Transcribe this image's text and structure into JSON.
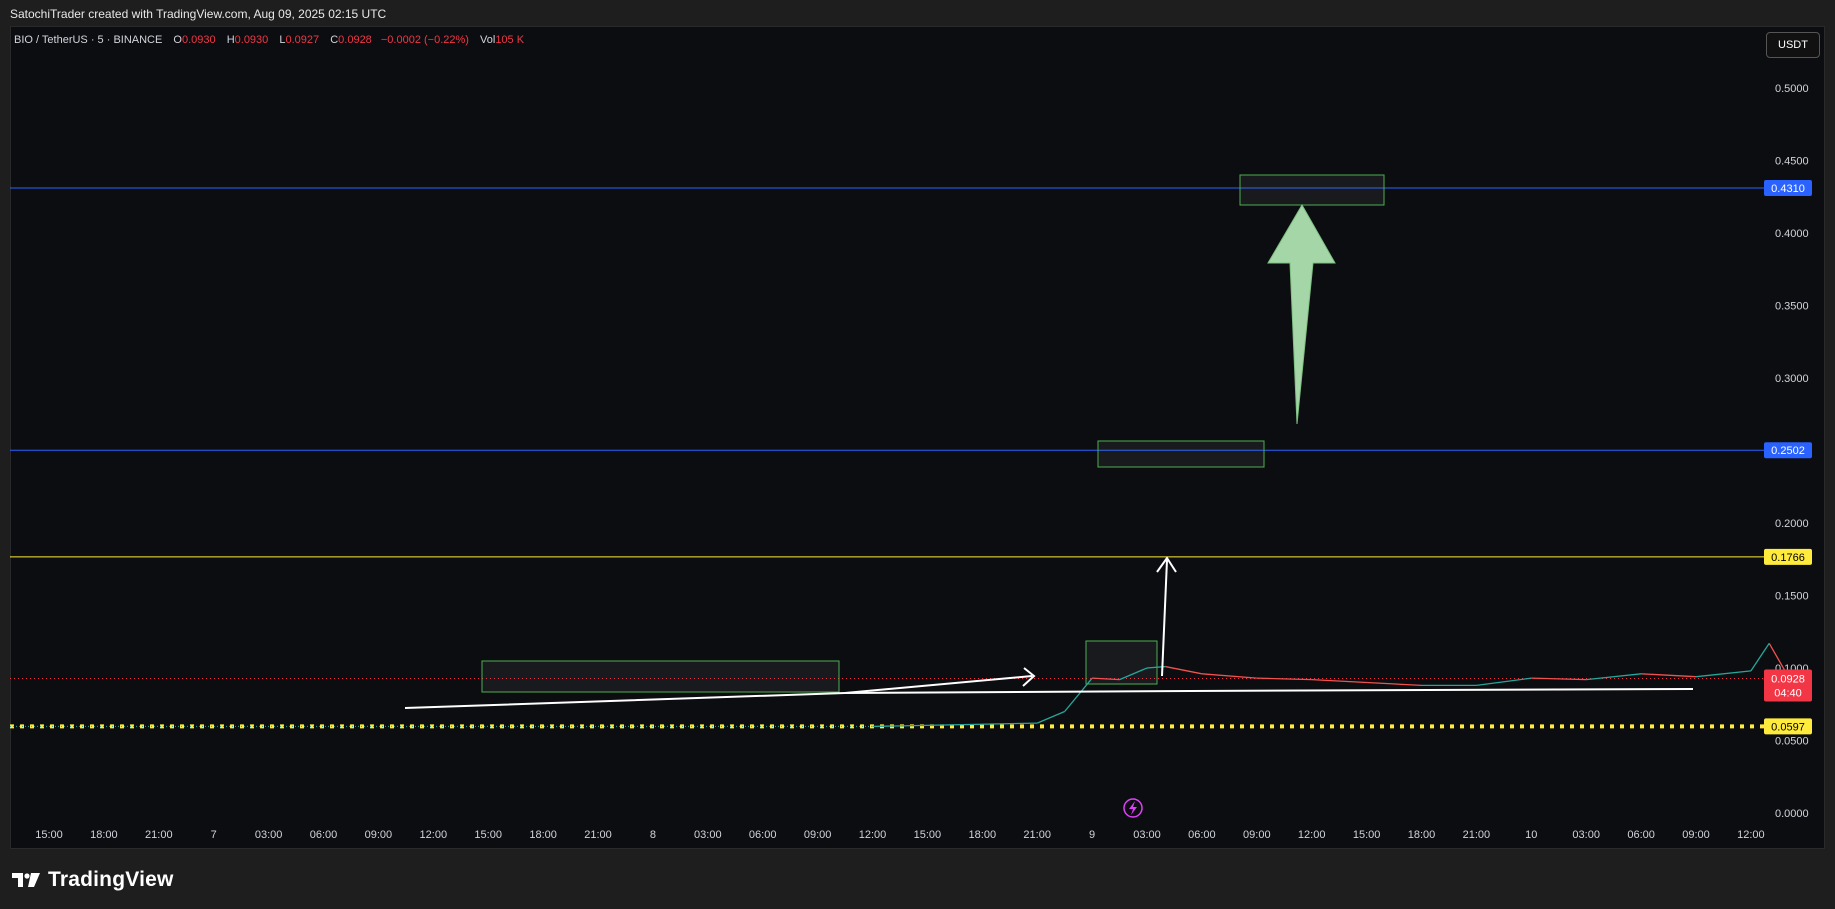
{
  "header": {
    "attribution": "SatochiTrader created with TradingView.com, Aug 09, 2025 02:15 UTC"
  },
  "legend": {
    "symbol": "BIO / TetherUS · 5 · BINANCE",
    "open_label": "O",
    "open": "0.0930",
    "high_label": "H",
    "high": "0.0930",
    "low_label": "L",
    "low": "0.0927",
    "close_label": "C",
    "close": "0.0928",
    "change": "−0.0002 (−0.22%)",
    "vol_label": "Vol",
    "vol": "105 K"
  },
  "currency_button": "USDT",
  "logo": {
    "text": "TradingView",
    "icon": "tradingview-logo-icon"
  },
  "colors": {
    "background": "#0c0d10",
    "blue_level": "#2962ff",
    "yellow_level": "#ffeb3b",
    "price_red": "#f23645",
    "box_green": "#4caf50",
    "big_arrow": "#a5d6a7",
    "volume_icon": "#e040fb"
  },
  "chart_data": {
    "type": "line",
    "title": "",
    "y_axis": {
      "ticks": [
        "0.5000",
        "0.4500",
        "0.4000",
        "0.3500",
        "0.3000",
        "0.2500",
        "0.2000",
        "0.1500",
        "0.1000",
        "0.0500",
        "0.0000"
      ],
      "ylim": [
        0,
        0.52
      ],
      "side": "right"
    },
    "x_axis": {
      "ticks": [
        "15:00",
        "18:00",
        "21:00",
        "7",
        "03:00",
        "06:00",
        "09:00",
        "12:00",
        "15:00",
        "18:00",
        "21:00",
        "8",
        "03:00",
        "06:00",
        "09:00",
        "12:00",
        "15:00",
        "18:00",
        "21:00",
        "9",
        "03:00",
        "06:00",
        "09:00",
        "12:00",
        "15:00",
        "18:00",
        "21:00",
        "10",
        "03:00",
        "06:00",
        "09:00",
        "12:00"
      ]
    },
    "price_levels": [
      {
        "value": 0.431,
        "label": "0.4310",
        "style": "solid",
        "color": "blue"
      },
      {
        "value": 0.2502,
        "label": "0.2502",
        "style": "solid",
        "color": "blue"
      },
      {
        "value": 0.1766,
        "label": "0.1766",
        "style": "solid",
        "color": "yellow"
      },
      {
        "value": 0.0597,
        "label": "0.0597",
        "style": "dotted",
        "color": "yellow"
      }
    ],
    "current_price": {
      "value": 0.0928,
      "label": "0.0928",
      "countdown": "04:40"
    },
    "series": [
      {
        "x": [
          "06:00",
          "09:00",
          "10:30",
          "12:00",
          "13:30",
          "15:00",
          "16:00",
          "18:00",
          "21:00",
          "8",
          "03:00",
          "06:00",
          "09:00",
          "12:00",
          "15:00",
          "18:00",
          "21:00",
          "9",
          "01:00",
          "02:00",
          "02:15"
        ],
        "y": [
          0.0597,
          0.062,
          0.07,
          0.093,
          0.092,
          0.1,
          0.101,
          0.096,
          0.093,
          0.092,
          0.09,
          0.088,
          0.088,
          0.093,
          0.092,
          0.096,
          0.094,
          0.098,
          0.117,
          0.095,
          0.0928
        ]
      }
    ],
    "annotations": [
      {
        "type": "rectangle",
        "x_range": [
          "15:00",
          "10:00"
        ],
        "y_range": [
          0.085,
          0.105
        ]
      },
      {
        "type": "rectangle",
        "x_range": [
          "9 00:00",
          "01:15"
        ],
        "y_range": [
          0.089,
          0.119
        ]
      },
      {
        "type": "rectangle",
        "x_range": [
          "9 00:15",
          "9 03:15"
        ],
        "y_range": [
          0.241,
          0.258
        ]
      },
      {
        "type": "rectangle",
        "x_range": [
          "9 03:00",
          "9 05:30"
        ],
        "y_range": [
          0.42,
          0.44
        ]
      },
      {
        "type": "arrow",
        "color": "white",
        "from": [
          "9 06:00",
          0.093
        ],
        "to": [
          "9 06:15",
          0.176
        ]
      },
      {
        "type": "arrow",
        "color": "light-green",
        "from": [
          "10:00",
          0.265
        ],
        "to": [
          "10:00",
          0.42
        ]
      },
      {
        "type": "trendline",
        "color": "white",
        "from": [
          "10:30",
          0.073
        ],
        "to": [
          "10 09:00",
          0.085
        ]
      },
      {
        "type": "arrow",
        "color": "white",
        "from": [
          "10:00",
          0.085
        ],
        "to": [
          "21:00",
          0.096
        ]
      }
    ]
  }
}
